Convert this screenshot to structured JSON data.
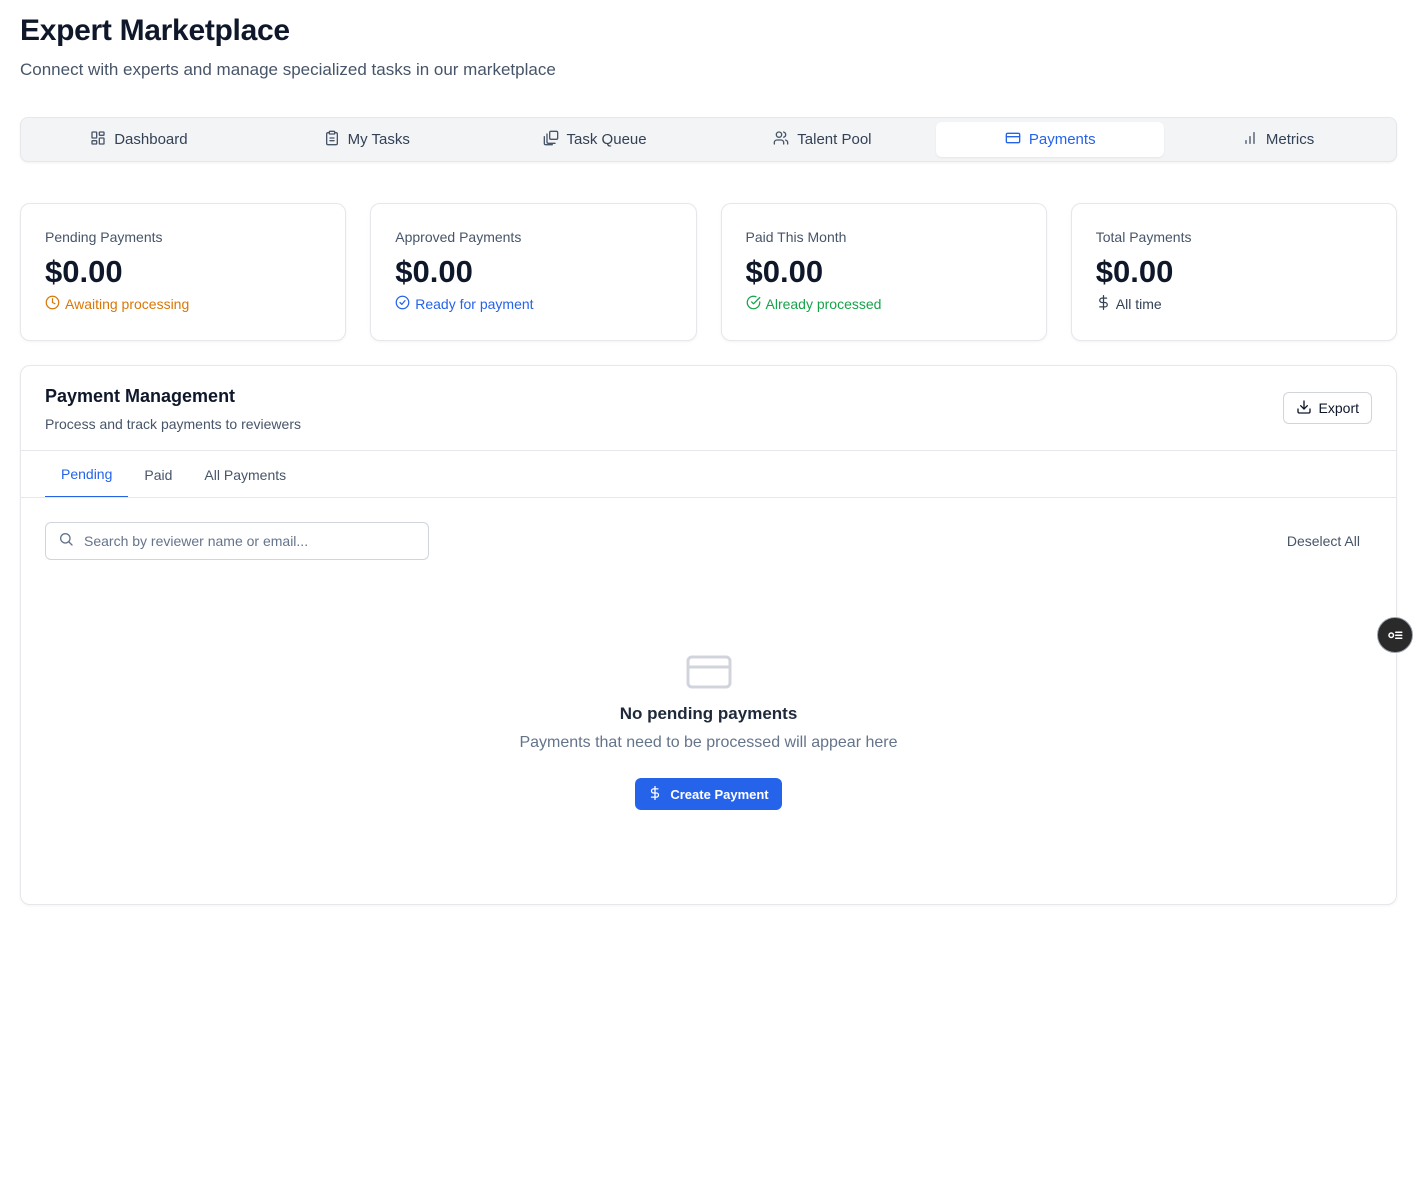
{
  "header": {
    "title": "Expert Marketplace",
    "subtitle": "Connect with experts and manage specialized tasks in our marketplace"
  },
  "main_tabs": [
    {
      "label": "Dashboard",
      "icon": "dashboard-icon"
    },
    {
      "label": "My Tasks",
      "icon": "clipboard-icon"
    },
    {
      "label": "Task Queue",
      "icon": "copy-stack-icon"
    },
    {
      "label": "Talent Pool",
      "icon": "users-icon"
    },
    {
      "label": "Payments",
      "icon": "credit-card-icon",
      "active": true
    },
    {
      "label": "Metrics",
      "icon": "bar-chart-icon"
    }
  ],
  "stats": [
    {
      "label": "Pending Payments",
      "value": "$0.00",
      "note": "Awaiting processing",
      "icon": "clock-icon",
      "color": "#d97706"
    },
    {
      "label": "Approved Payments",
      "value": "$0.00",
      "note": "Ready for payment",
      "icon": "check-circle-icon",
      "color": "#2563eb"
    },
    {
      "label": "Paid This Month",
      "value": "$0.00",
      "note": "Already processed",
      "icon": "check-circle-icon",
      "color": "#16a34a"
    },
    {
      "label": "Total Payments",
      "value": "$0.00",
      "note": "All time",
      "icon": "dollar-icon",
      "color": "#334155"
    }
  ],
  "panel": {
    "title": "Payment Management",
    "subtitle": "Process and track payments to reviewers",
    "export_label": "Export",
    "tabs": [
      {
        "label": "Pending",
        "active": true
      },
      {
        "label": "Paid"
      },
      {
        "label": "All Payments"
      }
    ],
    "search_placeholder": "Search by reviewer name or email...",
    "search_value": "",
    "deselect_label": "Deselect All",
    "empty": {
      "icon": "credit-card-icon",
      "title": "No pending payments",
      "description": "Payments that need to be processed will appear here",
      "button_label": "Create Payment",
      "button_icon": "dollar-icon"
    }
  },
  "colors": {
    "accent": "#2563eb",
    "text_primary": "#0f172a",
    "text_muted": "#475569"
  }
}
